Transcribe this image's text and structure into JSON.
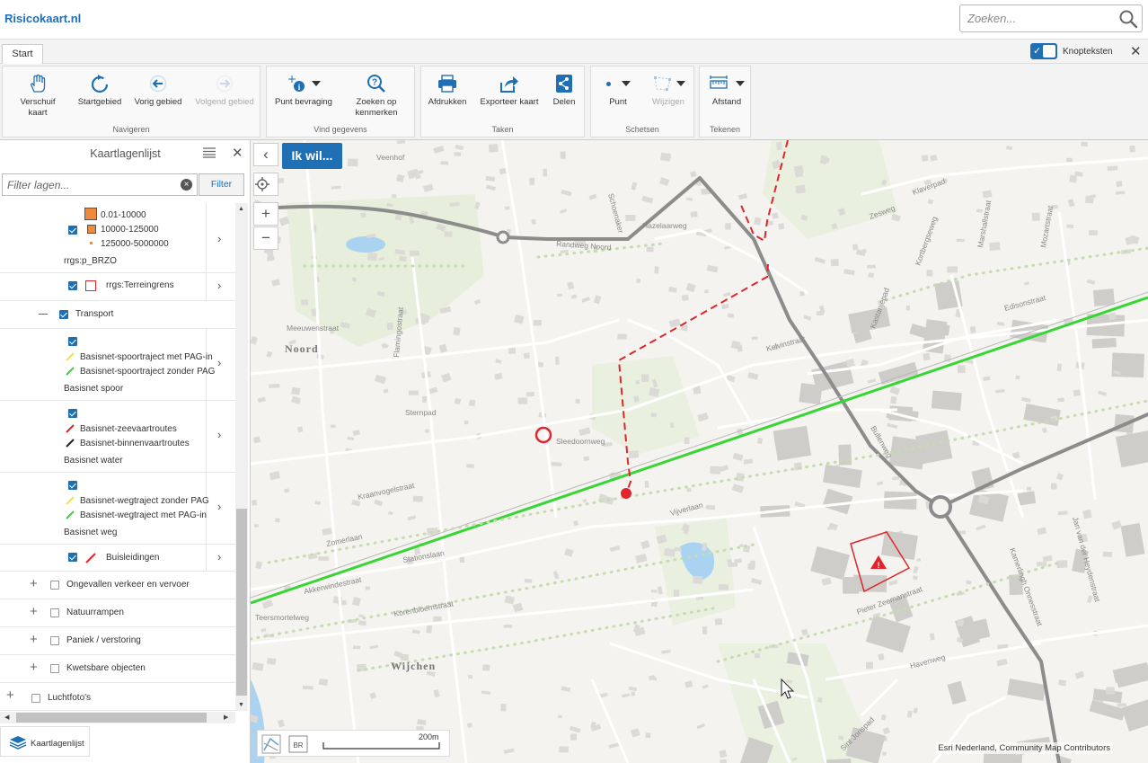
{
  "header": {
    "title": "Risicokaart.nl",
    "search_placeholder": "Zoeken..."
  },
  "ribbon": {
    "tab": "Start",
    "toggle_label": "Knopteksten",
    "toggle_on": true,
    "groups": {
      "navigeren": {
        "label": "Navigeren",
        "buttons": [
          "Verschuif kaart",
          "Startgebied",
          "Vorig gebied",
          "Volgend gebied"
        ]
      },
      "vind": {
        "label": "Vind gegevens",
        "buttons": [
          "Punt bevraging",
          "Zoeken op kenmerken"
        ]
      },
      "taken": {
        "label": "Taken",
        "buttons": [
          "Afdrukken",
          "Exporteer kaart",
          "Delen"
        ]
      },
      "schetsen": {
        "label": "Schetsen",
        "buttons": [
          "Punt",
          "Wijzigen"
        ]
      },
      "tekenen": {
        "label": "Tekenen",
        "buttons": [
          "Afstand"
        ]
      }
    }
  },
  "panel": {
    "title": "Kaartlagenlijst",
    "filter_placeholder": "Filter lagen...",
    "filter_button": "Filter",
    "footer_label": "Kaartlagenlijst",
    "layers": {
      "brzo_legend": [
        "0.01-10000",
        "10000-125000",
        "125000-5000000"
      ],
      "brzo_name": "rrgs:p_BRZO",
      "terrein": "rrgs:Terreingrens",
      "transport": "Transport",
      "spoor_items": [
        "Basisnet-spoortraject met PAG-in",
        "Basisnet-spoortraject zonder PAG"
      ],
      "spoor_name": "Basisnet spoor",
      "water_items": [
        "Basisnet-zeevaartroutes",
        "Basisnet-binnenvaartroutes"
      ],
      "water_name": "Basisnet water",
      "weg_items": [
        "Basisnet-wegtraject zonder PAG",
        "Basisnet-wegtraject met PAG-in"
      ],
      "weg_name": "Basisnet weg",
      "buis": "Buisleidingen",
      "groups": [
        "Ongevallen verkeer en vervoer",
        "Natuurrampen",
        "Paniek / verstoring",
        "Kwetsbare objecten"
      ],
      "luchtfoto": "Luchtfoto's"
    }
  },
  "map": {
    "ik_wil": "Ik wil...",
    "attribution": "Esri Nederland, Community Map Contributors",
    "scale": "200m",
    "places": [
      "Noord",
      "Wijchen"
    ],
    "streets": [
      "Veenhof",
      "Schoenaker",
      "Hazelaarweg",
      "Klaverpad",
      "Zesweg",
      "Kortbergseweg",
      "Marshallstraat",
      "Mozartstraat",
      "Edisonstraat",
      "Randweg Noord",
      "Meeuwenstraat",
      "Flamingostraat",
      "Kastanjepad",
      "Kelvinstraat",
      "Sternpad",
      "Sleedoornweg",
      "Kraanvogelstraat",
      "Vijverlaan",
      "Stationslaan",
      "Zomerlaan",
      "Akkerwindestraat",
      "Korenbloemstraat",
      "Teersmortelweg",
      "Pieter Zeemanstraat",
      "Havenweg",
      "Jan van der Heydenstraat",
      "Kamerlingh Onnesstraat",
      "Sint Jorispad",
      "Bullenweg"
    ],
    "colors": {
      "rail": "#38d635",
      "pipeline": "#e0252b",
      "road": "#8c8c8c",
      "accent": "#1f6fb5"
    }
  }
}
